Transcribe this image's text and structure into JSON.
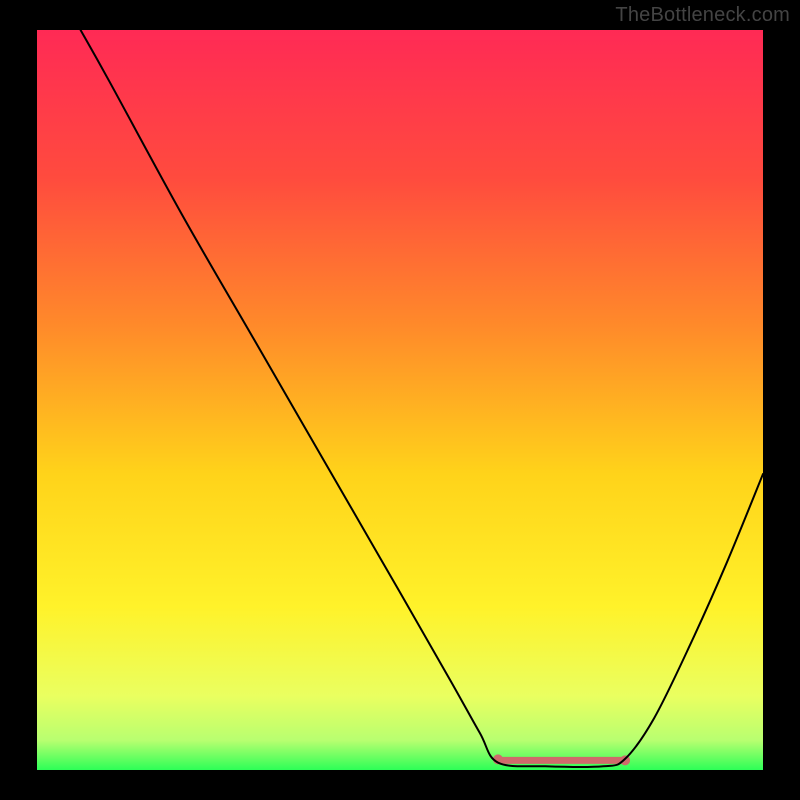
{
  "watermark": "TheBottleneck.com",
  "chart_data": {
    "type": "line",
    "title": "",
    "xlabel": "",
    "ylabel": "",
    "xlim": [
      0,
      100
    ],
    "ylim": [
      0,
      100
    ],
    "gradient_stops": [
      {
        "offset": 0,
        "color": "#ff2a55"
      },
      {
        "offset": 20,
        "color": "#ff4b3e"
      },
      {
        "offset": 40,
        "color": "#ff8a2a"
      },
      {
        "offset": 60,
        "color": "#ffd31a"
      },
      {
        "offset": 78,
        "color": "#fff22a"
      },
      {
        "offset": 90,
        "color": "#eaff60"
      },
      {
        "offset": 96,
        "color": "#b8ff70"
      },
      {
        "offset": 100,
        "color": "#2dff57"
      }
    ],
    "series": [
      {
        "name": "curve",
        "color": "#000000",
        "width": 2,
        "points": [
          {
            "x": 6,
            "y": 100
          },
          {
            "x": 10,
            "y": 93
          },
          {
            "x": 20,
            "y": 75
          },
          {
            "x": 30,
            "y": 58
          },
          {
            "x": 40,
            "y": 41
          },
          {
            "x": 50,
            "y": 24
          },
          {
            "x": 57,
            "y": 12
          },
          {
            "x": 61,
            "y": 5
          },
          {
            "x": 63.5,
            "y": 1
          },
          {
            "x": 70,
            "y": 0.5
          },
          {
            "x": 78,
            "y": 0.5
          },
          {
            "x": 81,
            "y": 1.5
          },
          {
            "x": 85,
            "y": 7
          },
          {
            "x": 90,
            "y": 17
          },
          {
            "x": 95,
            "y": 28
          },
          {
            "x": 100,
            "y": 40
          }
        ]
      }
    ],
    "highlight_band": {
      "color": "#cf6b6b",
      "cap_fill": "#cf6b6b",
      "y": 1.3,
      "thickness_px": 7,
      "x_start": 63.5,
      "x_end": 81,
      "cap_radius_px": 5
    }
  }
}
